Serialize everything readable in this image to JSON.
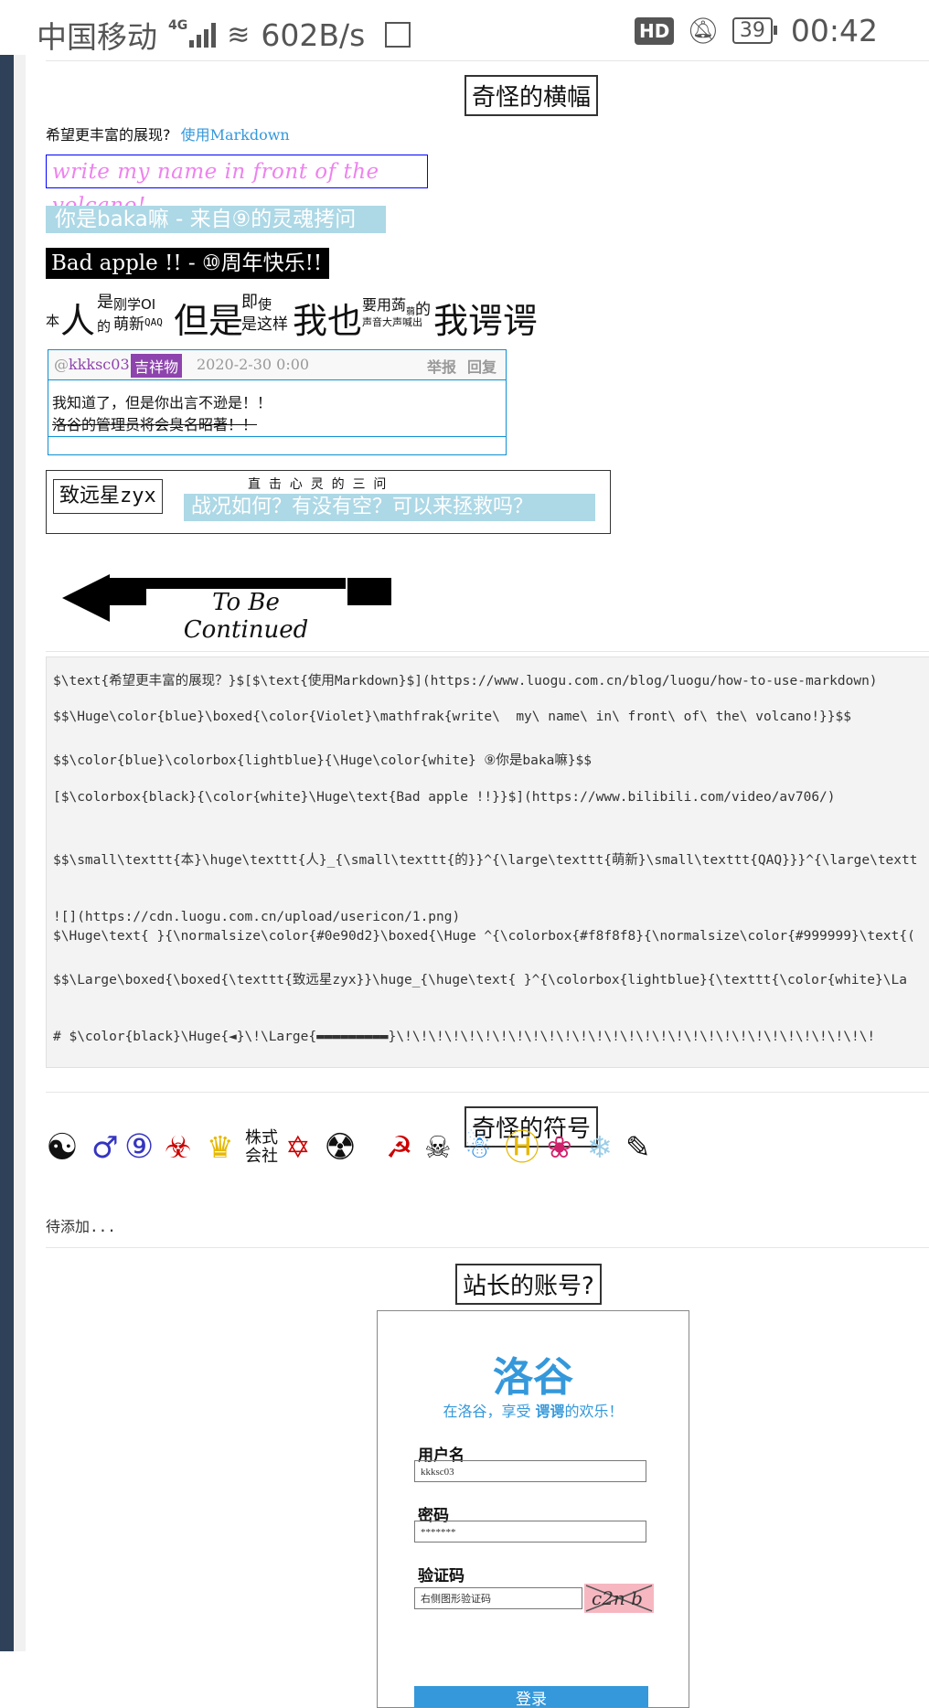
{
  "status_bar": {
    "carrier": "中国移动",
    "network": "4G",
    "speed": "602B/s",
    "battery": "39",
    "time": "00:42"
  },
  "sections": {
    "weird_banners": "奇怪的横幅",
    "weird_symbols": "奇怪的符号",
    "admin_account": "站长的账号?"
  },
  "markdown_line": {
    "prefix": "希望更丰富的展现?",
    "link": "使用Markdown"
  },
  "banners": {
    "volcano": "write my name in front of the volcano!",
    "baka": "你是baka嘛 - 来自⑨的灵魂拷问",
    "bad_apple": "Bad apple !! - ⑩周年快乐!!"
  },
  "mixed_text": {
    "ben": "本",
    "ren": "人",
    "shi1": "是",
    "de1": "的",
    "ganxue": "刚学OI",
    "mengxin": "萌新",
    "qaq": "QAQ",
    "danshi": "但是",
    "ji": "即",
    "shi2": "使",
    "shi_zheyang": "是这样",
    "woye": "我也",
    "yaoyong": "要用",
    "ruo": "蒟",
    "ruo2": "蒻",
    "de2": "的",
    "shengyin": "声音大声喊出",
    "woxx": "我谔谔"
  },
  "comment": {
    "at": "@",
    "user": "kkksc03",
    "badge": "吉祥物",
    "date": "2020-2-30 0:00",
    "report": "举报",
    "reply": "回复",
    "line1": "我知道了，但是你出言不逊是！！",
    "line2": "洛谷的管理员将会臭名昭著！！"
  },
  "soul": {
    "name": "致远星zyx",
    "sup": "直  击  心  灵  的  三  问",
    "question": "战况如何？有没有空？可以来拯救吗？"
  },
  "tbc": {
    "text": "To Be Continued"
  },
  "code_lines": [
    "$\\text{希望更丰富的展现？}$[$\\text{使用Markdown}$](https://www.luogu.com.cn/blog/luogu/how-to-use-markdown)",
    "$$\\Huge\\color{blue}\\boxed{\\color{Violet}\\mathfrak{write\\  my\\ name\\ in\\ front\\ of\\ the\\ volcano!}}$$",
    "$$\\color{blue}\\colorbox{lightblue}{\\Huge\\color{white} ⑨你是baka嘛}$$",
    "[$\\colorbox{black}{\\color{white}\\Huge\\text{Bad apple !!}}$](https://www.bilibili.com/video/av706/)",
    "$$\\small\\texttt{本}\\huge\\texttt{人}_{\\small\\texttt{的}}^{\\large\\texttt{萌新}\\small\\texttt{QAQ}}}^{\\large\\textt",
    "![](https://cdn.luogu.com.cn/upload/usericon/1.png)",
    "$\\Huge\\text{ }{\\normalsize\\color{#0e90d2}\\boxed{\\Huge ^{\\colorbox{#f8f8f8}{\\normalsize\\color{#999999}\\text{(",
    "$$\\Large\\boxed{\\boxed{\\texttt{致远星zyx}}\\huge_{\\huge\\text{ }^{\\colorbox{lightblue}{\\texttt{\\color{white}\\La",
    "# $\\color{black}\\Huge{◄}\\!\\Large{▬▬▬▬▬▬▬▬▬}\\!\\!\\!\\!\\!\\!\\!\\!\\!\\!\\!\\!\\!\\!\\!\\!\\!\\!\\!\\!\\!\\!\\!\\!\\!\\!\\!\\!\\!\\!"
  ],
  "symbols": [
    "☯",
    "♂",
    "⑨",
    "☣",
    "♛",
    "株式会社",
    "✡",
    "☢",
    "☭",
    "☠",
    "☃",
    "Ⓗ",
    "❀",
    "❄",
    "✎"
  ],
  "todo": "待添加...",
  "login": {
    "logo": "洛谷",
    "slogan_pre": "在洛谷，享受 ",
    "slogan_em": "谔谔",
    "slogan_post": "的欢乐！",
    "username_label": "用户名",
    "username_value": "kkksc03",
    "password_label": "密码",
    "password_value": "*******",
    "captcha_label": "验证码",
    "captcha_placeholder": "右侧图形验证码",
    "captcha_image": "c2n b",
    "submit": "登录"
  },
  "colors": {
    "link": "#3498db",
    "violet": "#ee82ee",
    "blue": "#0000ff",
    "lightblue": "#add8e6",
    "badge": "#8e44ad",
    "luogu": "#3498db"
  }
}
